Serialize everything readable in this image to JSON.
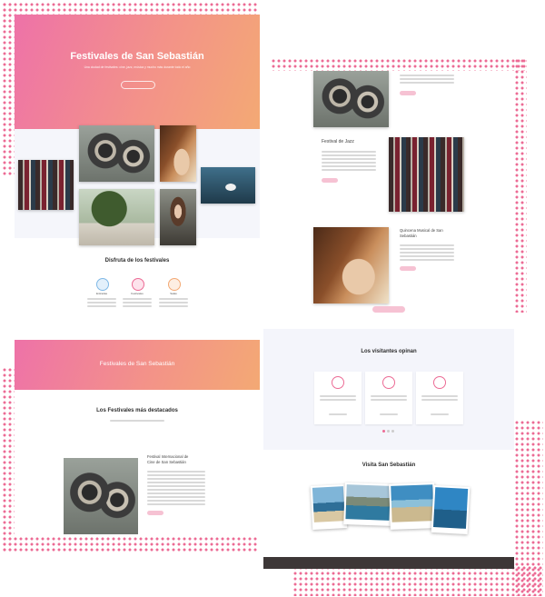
{
  "hero": {
    "title": "Festivales de San Sebastián",
    "subtitle_line1": "Una ciudad de festivales: cine, jazz, música y mucho más durante todo el año",
    "subtitle_line2": "",
    "button_label": ""
  },
  "enjoy": {
    "heading": "Disfruta de los festivales",
    "features": [
      {
        "label": "Entradas",
        "icon": "ticket-icon",
        "color": "#7fb8e6"
      },
      {
        "label": "Festivales",
        "icon": "music-icon",
        "color": "#ec6b95"
      },
      {
        "label": "Salas",
        "icon": "location-icon",
        "color": "#f3a974"
      }
    ]
  },
  "festival_list": [
    {
      "title": "",
      "image": "projector"
    },
    {
      "title": "Festival de Jazz",
      "image": "records"
    },
    {
      "title": "Quincena Musical de San Sebastián",
      "image": "violin"
    }
  ],
  "page2": {
    "banner_title": "Festivales de San Sebastián",
    "highlight_heading": "Los Festivales más destacados",
    "featured": {
      "title_line1": "Festival Internacional de",
      "title_line2": "Cine de San Sebastián"
    }
  },
  "testimonials": {
    "heading": "Los visitantes opinan",
    "count": 3
  },
  "visit": {
    "heading": "Visita San Sebastián",
    "photos": [
      "beach-1",
      "beach-2",
      "beach-3",
      "beach-4"
    ]
  },
  "colors": {
    "accent": "#ec6b95",
    "gradient_start": "#ee72a8",
    "gradient_end": "#f3a974",
    "footer": "#3d3737"
  }
}
